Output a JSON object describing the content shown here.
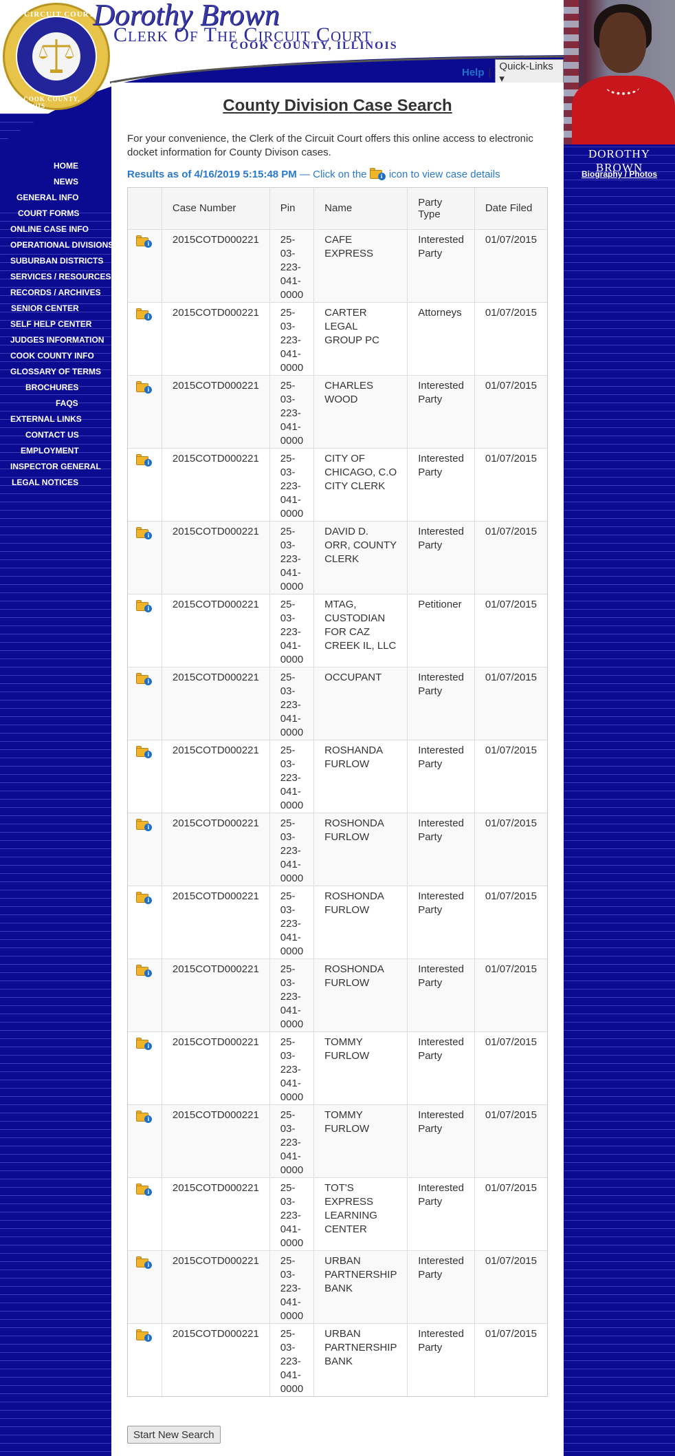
{
  "header": {
    "official_script": "Dorothy Brown",
    "court_title": "Clerk Of The Circuit Court",
    "county": "COOK COUNTY, ILLINOIS",
    "help_label": "Help",
    "separator": "|",
    "quick_links_label": "Quick-Links ▾",
    "seal_top": "CIRCUIT COURT",
    "seal_bottom": "OF COOK COUNTY, ILLINOIS"
  },
  "right_panel": {
    "name": "DOROTHY BROWN",
    "bio_link": "Biography / Photos"
  },
  "nav": {
    "items": [
      {
        "label": "HOME"
      },
      {
        "label": "NEWS"
      },
      {
        "label": "GENERAL INFO"
      },
      {
        "label": "COURT FORMS"
      },
      {
        "label": "ONLINE CASE INFO"
      },
      {
        "label": "OPERATIONAL DIVISIONS"
      },
      {
        "label": "SUBURBAN DISTRICTS"
      },
      {
        "label": "SERVICES / RESOURCES"
      },
      {
        "label": "RECORDS / ARCHIVES"
      },
      {
        "label": "SENIOR CENTER"
      },
      {
        "label": "SELF HELP CENTER"
      },
      {
        "label": "JUDGES INFORMATION"
      },
      {
        "label": "COOK COUNTY INFO"
      },
      {
        "label": "GLOSSARY OF TERMS"
      },
      {
        "label": "BROCHURES"
      },
      {
        "label": "FAQS"
      },
      {
        "label": "EXTERNAL LINKS"
      },
      {
        "label": "CONTACT US"
      },
      {
        "label": "EMPLOYMENT"
      },
      {
        "label": "INSPECTOR GENERAL"
      },
      {
        "label": "LEGAL NOTICES"
      }
    ]
  },
  "main": {
    "title": "County Division Case Search",
    "intro": "For your convenience, the Clerk of the Circuit Court offers this online access to electronic docket information for County Divison cases.",
    "results_bold": "Results as of 4/16/2019 5:15:48 PM",
    "results_mid": " — Click on the ",
    "results_end": " icon to view case details",
    "new_search_label": "Start New Search"
  },
  "table": {
    "headers": [
      "",
      "Case Number",
      "Pin",
      "Name",
      "Party Type",
      "Date Filed"
    ],
    "rows": [
      {
        "case": "2015COTD000221",
        "pin": "25-03-223-041-0000",
        "name": "CAFE EXPRESS",
        "party": "Interested Party",
        "date": "01/07/2015"
      },
      {
        "case": "2015COTD000221",
        "pin": "25-03-223-041-0000",
        "name": "CARTER LEGAL GROUP PC",
        "party": "Attorneys",
        "date": "01/07/2015"
      },
      {
        "case": "2015COTD000221",
        "pin": "25-03-223-041-0000",
        "name": "CHARLES WOOD",
        "party": "Interested Party",
        "date": "01/07/2015"
      },
      {
        "case": "2015COTD000221",
        "pin": "25-03-223-041-0000",
        "name": "CITY OF CHICAGO, C.O CITY CLERK",
        "party": "Interested Party",
        "date": "01/07/2015"
      },
      {
        "case": "2015COTD000221",
        "pin": "25-03-223-041-0000",
        "name": "DAVID D. ORR, COUNTY CLERK",
        "party": "Interested Party",
        "date": "01/07/2015"
      },
      {
        "case": "2015COTD000221",
        "pin": "25-03-223-041-0000",
        "name": "MTAG, CUSTODIAN FOR CAZ CREEK IL, LLC",
        "party": "Petitioner",
        "date": "01/07/2015"
      },
      {
        "case": "2015COTD000221",
        "pin": "25-03-223-041-0000",
        "name": "OCCUPANT",
        "party": "Interested Party",
        "date": "01/07/2015"
      },
      {
        "case": "2015COTD000221",
        "pin": "25-03-223-041-0000",
        "name": "ROSHANDA FURLOW",
        "party": "Interested Party",
        "date": "01/07/2015"
      },
      {
        "case": "2015COTD000221",
        "pin": "25-03-223-041-0000",
        "name": "ROSHONDA FURLOW",
        "party": "Interested Party",
        "date": "01/07/2015"
      },
      {
        "case": "2015COTD000221",
        "pin": "25-03-223-041-0000",
        "name": "ROSHONDA FURLOW",
        "party": "Interested Party",
        "date": "01/07/2015"
      },
      {
        "case": "2015COTD000221",
        "pin": "25-03-223-041-0000",
        "name": "ROSHONDA FURLOW",
        "party": "Interested Party",
        "date": "01/07/2015"
      },
      {
        "case": "2015COTD000221",
        "pin": "25-03-223-041-0000",
        "name": "TOMMY FURLOW",
        "party": "Interested Party",
        "date": "01/07/2015"
      },
      {
        "case": "2015COTD000221",
        "pin": "25-03-223-041-0000",
        "name": "TOMMY FURLOW",
        "party": "Interested Party",
        "date": "01/07/2015"
      },
      {
        "case": "2015COTD000221",
        "pin": "25-03-223-041-0000",
        "name": "TOT'S EXPRESS LEARNING CENTER",
        "party": "Interested Party",
        "date": "01/07/2015"
      },
      {
        "case": "2015COTD000221",
        "pin": "25-03-223-041-0000",
        "name": "URBAN PARTNERSHIP BANK",
        "party": "Interested Party",
        "date": "01/07/2015"
      },
      {
        "case": "2015COTD000221",
        "pin": "25-03-223-041-0000",
        "name": "URBAN PARTNERSHIP BANK",
        "party": "Interested Party",
        "date": "01/07/2015"
      }
    ]
  },
  "colors": {
    "nav_blue": "#0a0a8c",
    "link_blue": "#2471c9",
    "results_blue": "#2a78c8",
    "folder_yellow": "#f0b429"
  },
  "icons": {
    "folder": "folder-info-icon",
    "seal": "court-seal-logo"
  }
}
